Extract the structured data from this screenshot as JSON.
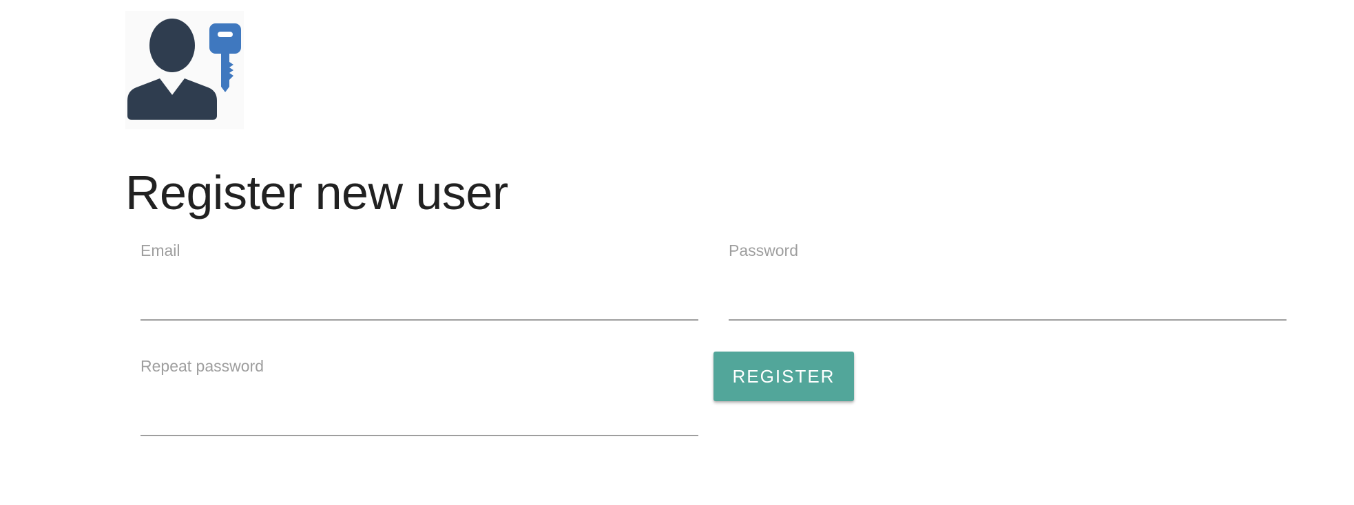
{
  "header": {
    "logo_icon": "user-key-icon",
    "title": "Register new user"
  },
  "form": {
    "email": {
      "label": "Email",
      "value": ""
    },
    "password": {
      "label": "Password",
      "value": ""
    },
    "repeat_password": {
      "label": "Repeat password",
      "value": ""
    },
    "register_label": "REGISTER"
  },
  "colors": {
    "accent": "#52a69a",
    "person": "#2f3d4f",
    "key": "#3f78bf"
  }
}
